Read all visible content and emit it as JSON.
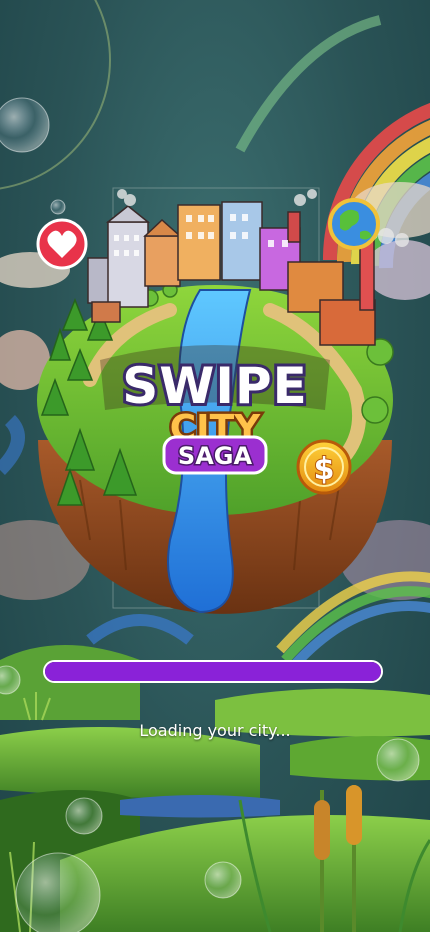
{
  "app": {
    "title_line1": "SWIPE",
    "title_line2": "CITY",
    "title_line3": "SAGA"
  },
  "loading": {
    "progress": 1.0,
    "message": "Loading your city..."
  },
  "coin_symbol": "$",
  "icons": {
    "heart": "heart-icon",
    "globe": "globe-icon",
    "coin": "coin-icon"
  },
  "colors": {
    "progress_fill": "#8a22d8",
    "saga_badge": "#9b2fd0",
    "grass": "#6fbf2c",
    "river": "#3aa4e8"
  }
}
